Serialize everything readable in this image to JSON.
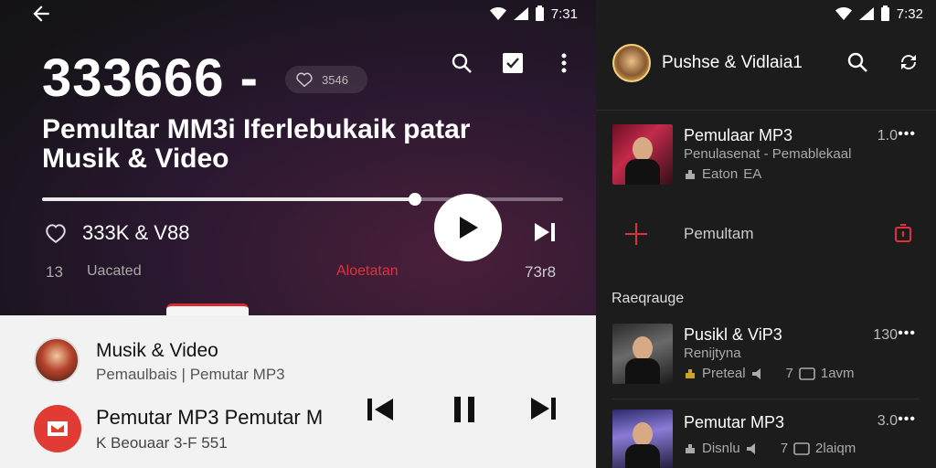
{
  "left": {
    "status": {
      "time": "7:31"
    },
    "count": "333666 -",
    "count_pill": "3546",
    "title": "Pemultar MM3i Iferlebukaik patar Musik & Video",
    "likes": "333K & V88",
    "progress_fraction": 0.716,
    "meta": {
      "count": "13",
      "label": "Uacated",
      "red_label": "Aloetatan",
      "time": "73r8"
    },
    "colors": {
      "accent": "#e0323c"
    },
    "icons": [
      "back-arrow-icon",
      "search-icon",
      "checkbox-icon",
      "more-vertical-icon",
      "heart-icon",
      "play-icon",
      "skip-next-icon"
    ]
  },
  "mini_player": {
    "row1": {
      "title": "Musik & Video",
      "subtitle": "Pemaulbais | Pemutar MP3"
    },
    "row2": {
      "title": "Pemutar MP3 Pemutar M",
      "subtitle": "K Beouaar 3-F 551"
    }
  },
  "right": {
    "status": {
      "time": "7:32"
    },
    "header": {
      "title": "Pushse & Vidlaia1"
    },
    "items": [
      {
        "title": "Pemulaar MP3",
        "subtitle": "Penulasenat - Pemablekaal",
        "meta": "Eaton",
        "meta_tag": "EA",
        "duration": "1.0"
      },
      {
        "title": "Pusikl & ViP3",
        "subtitle": "Renijtyna",
        "meta": "Preteal",
        "meta2": "7",
        "meta3": "1avm",
        "duration": "130"
      },
      {
        "title": "Pemutar MP3",
        "subtitle": "",
        "meta": "Disnlu",
        "meta2": "7",
        "meta3": "2laiqm",
        "duration": "3.0"
      }
    ],
    "add_label": "Pemultam",
    "section_label": "Raeqrauge",
    "more_label": "•••"
  }
}
